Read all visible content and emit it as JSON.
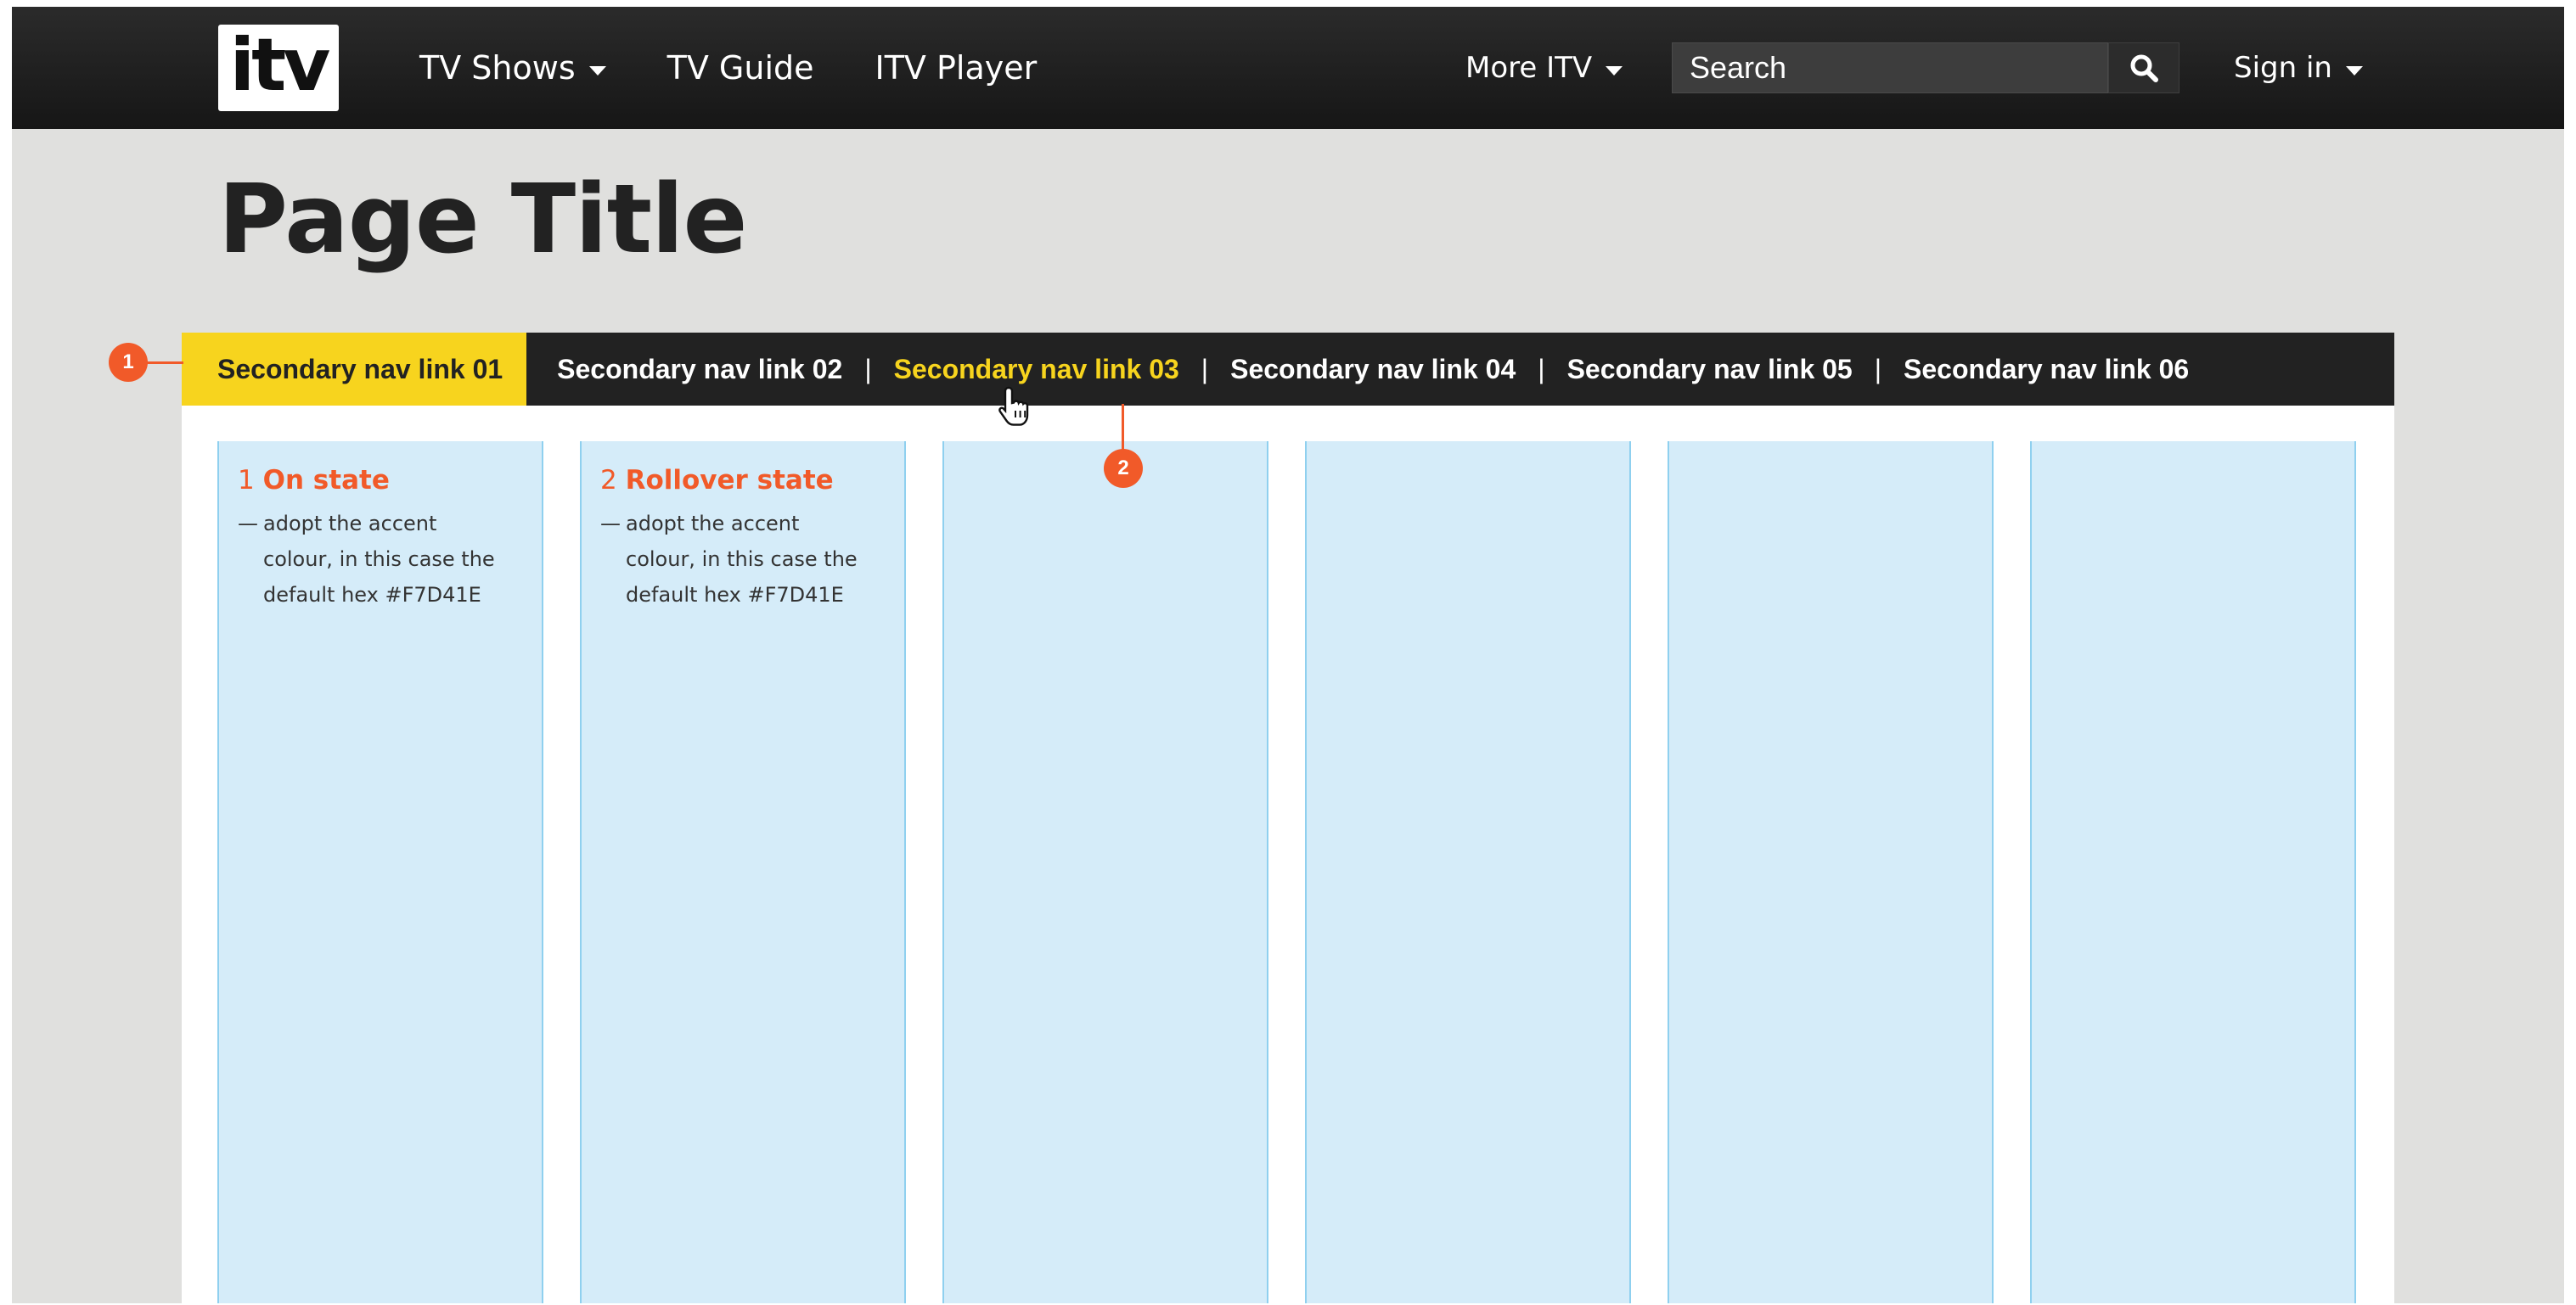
{
  "header": {
    "logo_text": "itv",
    "nav": [
      {
        "label": "TV Shows",
        "dropdown": true
      },
      {
        "label": "TV Guide",
        "dropdown": false
      },
      {
        "label": "ITV Player",
        "dropdown": false
      }
    ],
    "more": {
      "label": "More ITV"
    },
    "search": {
      "placeholder": "Search",
      "icon": "search-icon"
    },
    "signin": {
      "label": "Sign in"
    }
  },
  "page": {
    "title": "Page Title"
  },
  "secondary_nav": {
    "links": [
      {
        "label": "Secondary nav link 01",
        "state": "on"
      },
      {
        "label": "Secondary nav link 02",
        "state": "default"
      },
      {
        "label": "Secondary nav link 03",
        "state": "rollover"
      },
      {
        "label": "Secondary nav link 04",
        "state": "default"
      },
      {
        "label": "Secondary nav link 05",
        "state": "default"
      },
      {
        "label": "Secondary nav link 06",
        "state": "default"
      }
    ],
    "separator": "|"
  },
  "annotations": {
    "markers": [
      "1",
      "2"
    ],
    "notes": [
      {
        "number": "1",
        "title": "On state",
        "dash": "—",
        "body": "adopt the accent colour, in this case the default hex #F7D41E"
      },
      {
        "number": "2",
        "title": "Rollover state",
        "dash": "—",
        "body": "adopt the accent colour, in this case the default hex #F7D41E"
      }
    ]
  },
  "colors": {
    "accent": "#F7D41E",
    "annotation": "#F15A29",
    "header_bg": "#1E1E1E",
    "page_bg": "#E0E0DE",
    "grid_column": "#D5ECF9"
  }
}
